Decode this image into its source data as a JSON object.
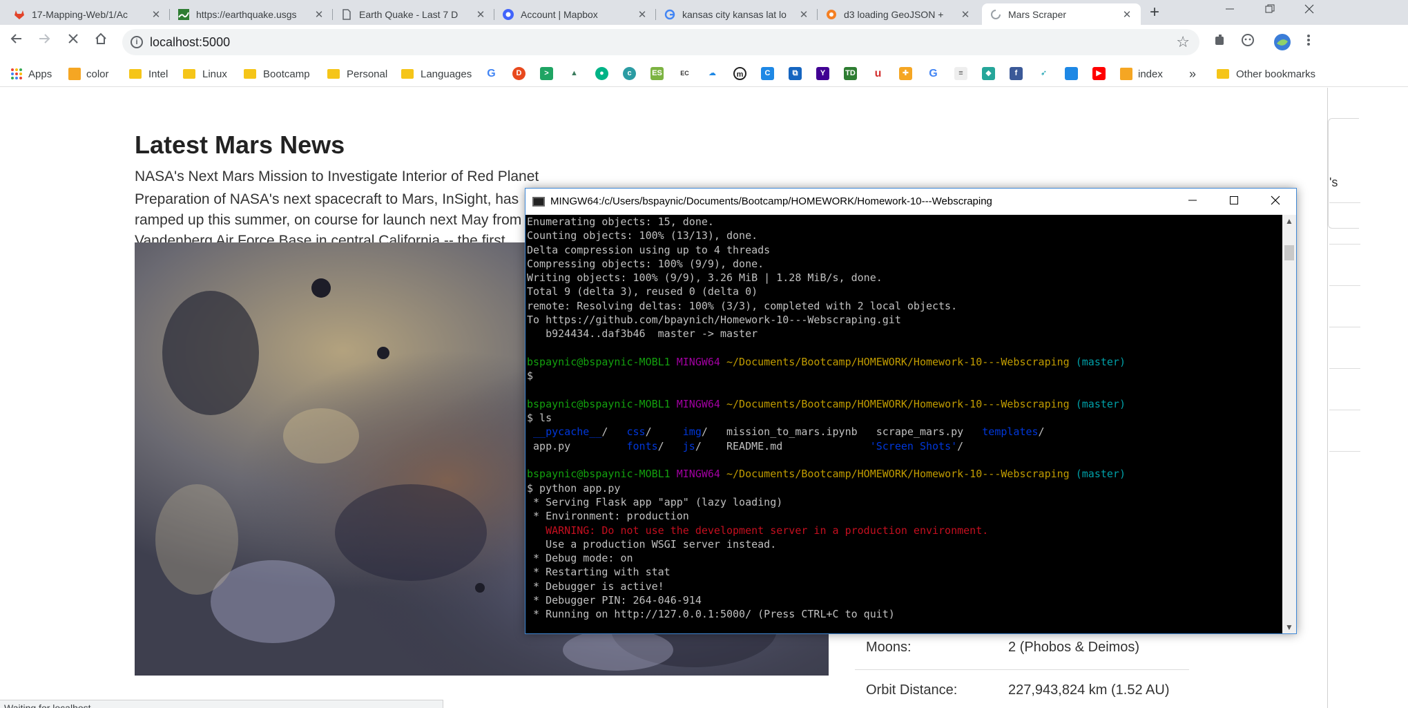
{
  "browser": {
    "tabs": [
      {
        "title": "17-Mapping-Web/1/Ac",
        "favicon_color": "#e24329"
      },
      {
        "title": "https://earthquake.usgs",
        "favicon_color": "#2e7d32"
      },
      {
        "title": "Earth Quake - Last 7 D",
        "favicon_color": "#5f6368"
      },
      {
        "title": "Account | Mapbox",
        "favicon_color": "#4264fb"
      },
      {
        "title": "kansas city kansas lat lo",
        "favicon_color": "#4285f4"
      },
      {
        "title": "d3 loading GeoJSON +",
        "favicon_color": "#f48024"
      },
      {
        "title": "Mars Scraper",
        "favicon_color": "#9aa0a6"
      }
    ],
    "new_tab_glyph": "+",
    "address": "localhost:5000",
    "bookmarks": [
      {
        "label": "Apps",
        "kind": "apps"
      },
      {
        "label": "color",
        "kind": "fav"
      },
      {
        "label": "Intel",
        "kind": "folder"
      },
      {
        "label": "Linux",
        "kind": "folder"
      },
      {
        "label": "Bootcamp",
        "kind": "folder"
      },
      {
        "label": "Personal",
        "kind": "folder"
      },
      {
        "label": "Languages",
        "kind": "folder"
      },
      {
        "label": "index",
        "kind": "fav"
      },
      {
        "label": "Other bookmarks",
        "kind": "folder"
      }
    ],
    "bookmark_overflow": "»",
    "status": "Waiting for localhost..."
  },
  "page": {
    "news_title": "Latest Mars News",
    "news_headline": "NASA's Next Mars Mission to Investigate Interior of Red Planet",
    "news_body": "Preparation of NASA's next spacecraft to Mars, InSight, has ramped up this summer, on course for launch next May from Vandenberg Air Force Base in central California -- the first interplanetary launch in history from America's West Coast.",
    "right_card_partial": "'s",
    "facts": [
      {
        "key": "Moons:",
        "value": "2 (Phobos & Deimos)"
      },
      {
        "key": "Orbit Distance:",
        "value": "227,943,824 km (1.52 AU)"
      }
    ]
  },
  "terminal": {
    "title": "MINGW64:/c/Users/bspaynic/Documents/Bootcamp/HOMEWORK/Homework-10---Webscraping",
    "lines": [
      [
        {
          "t": "Enumerating objects: 15, done."
        }
      ],
      [
        {
          "t": "Counting objects: 100% (13/13), done."
        }
      ],
      [
        {
          "t": "Delta compression using up to 4 threads"
        }
      ],
      [
        {
          "t": "Compressing objects: 100% (9/9), done."
        }
      ],
      [
        {
          "t": "Writing objects: 100% (9/9), 3.26 MiB | 1.28 MiB/s, done."
        }
      ],
      [
        {
          "t": "Total 9 (delta 3), reused 0 (delta 0)"
        }
      ],
      [
        {
          "t": "remote: Resolving deltas: 100% (3/3), completed with 2 local objects."
        }
      ],
      [
        {
          "t": "To https://github.com/bpaynich/Homework-10---Webscraping.git"
        }
      ],
      [
        {
          "t": "   b924434..daf3b46  master -> master"
        }
      ],
      [
        {
          "t": ""
        }
      ],
      [
        {
          "t": "bspaynic@bspaynic-MOBL1 ",
          "c": "green"
        },
        {
          "t": "MINGW64 ",
          "c": "magenta"
        },
        {
          "t": "~/Documents/Bootcamp/HOMEWORK/Homework-10---Webscraping ",
          "c": "yellow"
        },
        {
          "t": "(master)",
          "c": "cyan"
        }
      ],
      [
        {
          "t": "$"
        }
      ],
      [
        {
          "t": ""
        }
      ],
      [
        {
          "t": "bspaynic@bspaynic-MOBL1 ",
          "c": "green"
        },
        {
          "t": "MINGW64 ",
          "c": "magenta"
        },
        {
          "t": "~/Documents/Bootcamp/HOMEWORK/Homework-10---Webscraping ",
          "c": "yellow"
        },
        {
          "t": "(master)",
          "c": "cyan"
        }
      ],
      [
        {
          "t": "$ ls"
        }
      ],
      [
        {
          "t": " __pycache__",
          "c": "blue"
        },
        {
          "t": "/   "
        },
        {
          "t": "css",
          "c": "blue"
        },
        {
          "t": "/     "
        },
        {
          "t": "img",
          "c": "blue"
        },
        {
          "t": "/   mission_to_mars.ipynb   scrape_mars.py   "
        },
        {
          "t": "templates",
          "c": "blue"
        },
        {
          "t": "/"
        }
      ],
      [
        {
          "t": " app.py         "
        },
        {
          "t": "fonts",
          "c": "blue"
        },
        {
          "t": "/   "
        },
        {
          "t": "js",
          "c": "blue"
        },
        {
          "t": "/    README.md              "
        },
        {
          "t": "'Screen Shots'",
          "c": "blue"
        },
        {
          "t": "/"
        }
      ],
      [
        {
          "t": ""
        }
      ],
      [
        {
          "t": "bspaynic@bspaynic-MOBL1 ",
          "c": "green"
        },
        {
          "t": "MINGW64 ",
          "c": "magenta"
        },
        {
          "t": "~/Documents/Bootcamp/HOMEWORK/Homework-10---Webscraping ",
          "c": "yellow"
        },
        {
          "t": "(master)",
          "c": "cyan"
        }
      ],
      [
        {
          "t": "$ python app.py"
        }
      ],
      [
        {
          "t": " * Serving Flask app \"app\" (lazy loading)"
        }
      ],
      [
        {
          "t": " * Environment: production"
        }
      ],
      [
        {
          "t": "   WARNING: Do not use the development server in a production environment.",
          "c": "red"
        }
      ],
      [
        {
          "t": "   Use a production WSGI server instead."
        }
      ],
      [
        {
          "t": " * Debug mode: on"
        }
      ],
      [
        {
          "t": " * Restarting with stat"
        }
      ],
      [
        {
          "t": " * Debugger is active!"
        }
      ],
      [
        {
          "t": " * Debugger PIN: 264-046-914"
        }
      ],
      [
        {
          "t": " * Running on http://127.0.0.1:5000/ (Press CTRL+C to quit)"
        }
      ]
    ]
  },
  "colors": {
    "green": "#13a10e",
    "magenta": "#a200a2",
    "yellow": "#c19c00",
    "cyan": "#00a0a8",
    "blue": "#0037da",
    "red": "#c50f1f"
  }
}
